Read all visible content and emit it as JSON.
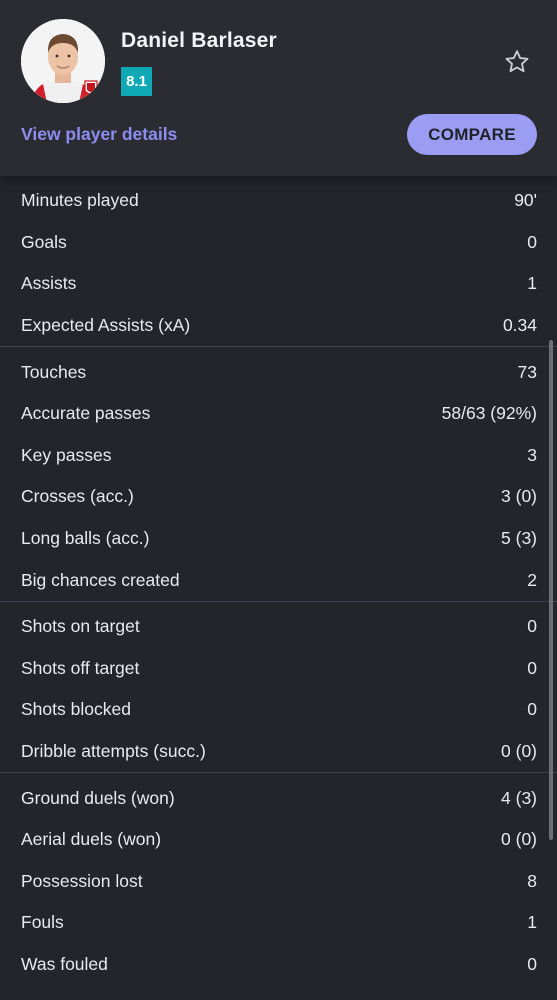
{
  "player": {
    "name": "Daniel Barlaser",
    "rating": "8.1",
    "rating_color": "#0fa8b5",
    "avatar_icon": "player-photo",
    "club_crest_icon": "club-crest-icon"
  },
  "actions": {
    "details_label": "View player details",
    "compare_label": "COMPARE",
    "favorite_icon": "star-outline-icon"
  },
  "stats": {
    "general": [
      {
        "label": "Minutes played",
        "value": "90'"
      },
      {
        "label": "Goals",
        "value": "0"
      },
      {
        "label": "Assists",
        "value": "1"
      },
      {
        "label": "Expected Assists (xA)",
        "value": "0.34"
      }
    ],
    "passing": [
      {
        "label": "Touches",
        "value": "73"
      },
      {
        "label": "Accurate passes",
        "value": "58/63 (92%)"
      },
      {
        "label": "Key passes",
        "value": "3"
      },
      {
        "label": "Crosses (acc.)",
        "value": "3 (0)"
      },
      {
        "label": "Long balls (acc.)",
        "value": "5 (3)"
      },
      {
        "label": "Big chances created",
        "value": "2"
      }
    ],
    "attacking": [
      {
        "label": "Shots on target",
        "value": "0"
      },
      {
        "label": "Shots off target",
        "value": "0"
      },
      {
        "label": "Shots blocked",
        "value": "0"
      },
      {
        "label": "Dribble attempts (succ.)",
        "value": "0 (0)"
      }
    ],
    "duels": [
      {
        "label": "Ground duels (won)",
        "value": "4 (3)"
      },
      {
        "label": "Aerial duels (won)",
        "value": "0 (0)"
      },
      {
        "label": "Possession lost",
        "value": "8"
      },
      {
        "label": "Fouls",
        "value": "1"
      },
      {
        "label": "Was fouled",
        "value": "0"
      }
    ]
  }
}
